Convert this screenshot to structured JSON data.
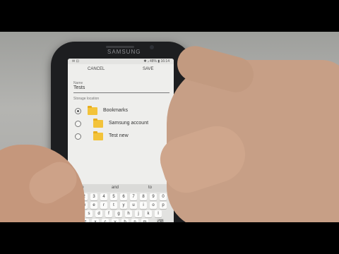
{
  "phone": {
    "brand": "SAMSUNG"
  },
  "status_bar": {
    "left": "✉ ⊡",
    "right": "✱ ᵢₗ 48% ▮ 16:14"
  },
  "dialog": {
    "cancel_label": "CANCEL",
    "save_label": "SAVE",
    "name_label": "Name",
    "name_value": "Tests",
    "storage_label": "Storage location",
    "locations": [
      {
        "label": "Bookmarks",
        "selected": true
      },
      {
        "label": "Samsung account",
        "selected": false
      },
      {
        "label": "Test new",
        "selected": false
      }
    ]
  },
  "keyboard": {
    "suggestions": [
      "are",
      "and",
      "to"
    ],
    "row_numbers": [
      "1",
      "2",
      "3",
      "4",
      "5",
      "6",
      "7",
      "8",
      "9",
      "0"
    ],
    "row_1": [
      "q",
      "w",
      "e",
      "r",
      "t",
      "y",
      "u",
      "i",
      "o",
      "p"
    ],
    "row_2": [
      "a",
      "s",
      "d",
      "f",
      "g",
      "h",
      "j",
      "k",
      "l"
    ],
    "row_3": [
      "⇧",
      "z",
      "x",
      "c",
      "v",
      "b",
      "n",
      "m",
      "⌫"
    ]
  },
  "colors": {
    "folder": "#f3c33a",
    "skin": "#c79f86",
    "phone_body": "#1d1e20"
  }
}
